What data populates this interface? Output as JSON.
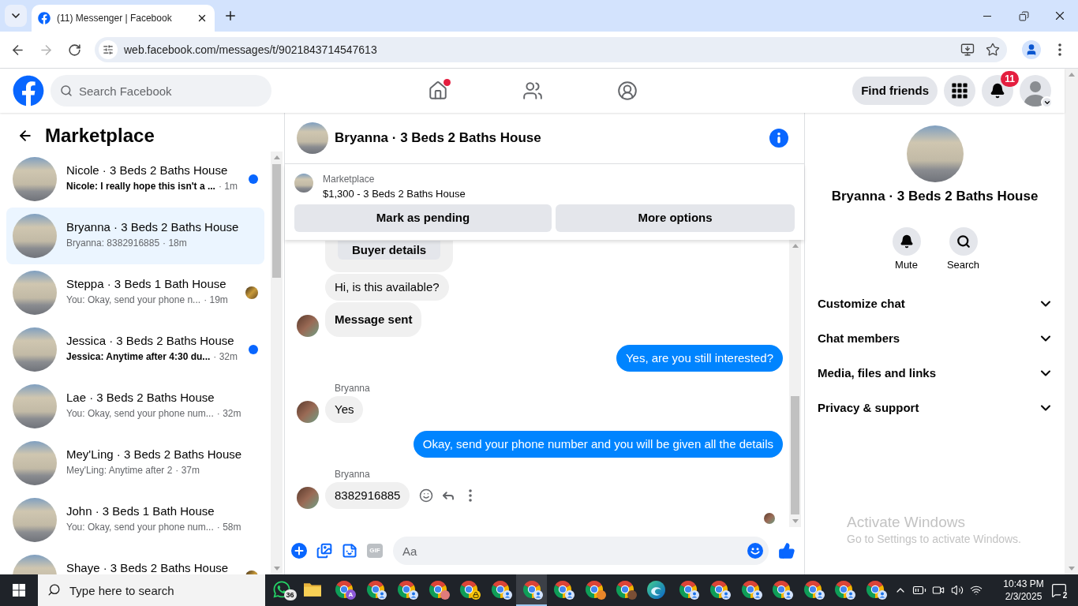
{
  "browser": {
    "tab": {
      "title": "(11) Messenger | Facebook"
    },
    "url": "web.facebook.com/messages/t/9021843714547613"
  },
  "header": {
    "search": {
      "placeholder": "Search Facebook"
    },
    "nav": [
      {
        "kind": "home",
        "selected": false,
        "alert": true
      },
      {
        "kind": "friends",
        "selected": false,
        "alert": false
      },
      {
        "kind": "groups",
        "selected": false,
        "alert": false
      }
    ],
    "find_friends": "Find friends",
    "notifications": "11"
  },
  "sidebar": {
    "title": "Marketplace",
    "conversations": [
      {
        "name": "Nicole · 3 Beds 2 Baths House",
        "preview": "Nicole: I really hope this isn't a ...",
        "time": "· 1m",
        "selected": false,
        "unread": true,
        "seen": false
      },
      {
        "name": "Bryanna · 3 Beds 2 Baths House",
        "preview": "Bryanna: 8382916885",
        "time": "· 18m",
        "selected": true,
        "unread": false,
        "seen": false
      },
      {
        "name": "Steppa · 3 Beds 1 Bath House",
        "preview": "You: Okay, send your phone n...",
        "time": "· 19m",
        "selected": false,
        "unread": false,
        "seen": true
      },
      {
        "name": "Jessica · 3 Beds 2 Baths House",
        "preview": "Jessica: Anytime after 4:30 du...",
        "time": "· 32m",
        "selected": false,
        "unread": true,
        "seen": false
      },
      {
        "name": "Lae · 3 Beds 2 Baths House",
        "preview": "You: Okay, send your phone num...",
        "time": "· 32m",
        "selected": false,
        "unread": false,
        "seen": false
      },
      {
        "name": "Mey'Ling · 3 Beds 2 Baths House",
        "preview": "Mey'Ling: Anytime after 2",
        "time": "· 37m",
        "selected": false,
        "unread": false,
        "seen": false
      },
      {
        "name": "John · 3 Beds 1 Bath House",
        "preview": "You: Okay, send your phone num...",
        "time": "· 58m",
        "selected": false,
        "unread": false,
        "seen": false
      },
      {
        "name": "Shaye · 3 Beds 2 Baths House",
        "selected": false,
        "unread": false,
        "seen": true
      }
    ]
  },
  "chat": {
    "title": "Bryanna · 3 Beds 2 Baths House",
    "listing": {
      "label": "Marketplace",
      "text": "$1,300 - 3 Beds 2 Baths House",
      "actions": [
        "Mark as pending",
        "More options"
      ]
    },
    "messages": [
      {
        "kind": "card",
        "outgoing": false,
        "button": "Buyer details",
        "avatar": false
      },
      {
        "kind": "text",
        "outgoing": false,
        "text": "Hi, is this available?",
        "avatar": false
      },
      {
        "kind": "notice",
        "outgoing": false,
        "text": "Message sent",
        "avatar": true
      },
      {
        "kind": "text",
        "outgoing": true,
        "text": "Yes, are you still interested?"
      },
      {
        "kind": "text",
        "outgoing": false,
        "sender": "Bryanna",
        "text": "Yes",
        "avatar": true
      },
      {
        "kind": "text",
        "outgoing": true,
        "text": "Okay, send your phone number and you will be given all the details"
      },
      {
        "kind": "text",
        "outgoing": false,
        "sender": "Bryanna",
        "text": "8382916885",
        "avatar": true,
        "actions": true
      }
    ],
    "seen": true,
    "composer": {
      "tools": [
        {
          "kind": "plus"
        },
        {
          "kind": "photo"
        },
        {
          "kind": "sticker"
        },
        {
          "kind": "gif",
          "label": "GIF"
        }
      ],
      "placeholder": "Aa"
    }
  },
  "details": {
    "title": "Bryanna · 3 Beds 2 Baths House",
    "actions": [
      {
        "kind": "mute",
        "label": "Mute"
      },
      {
        "kind": "search",
        "label": "Search"
      }
    ],
    "sections": [
      {
        "label": "Customize chat",
        "expanded": false
      },
      {
        "label": "Chat members",
        "expanded": false
      },
      {
        "label": "Media, files and links",
        "expanded": false
      },
      {
        "label": "Privacy & support",
        "expanded": false
      }
    ]
  },
  "windows_notice": {
    "title": "Activate Windows",
    "text": "Go to Settings to activate Windows."
  },
  "taskbar": {
    "search": {
      "placeholder": "Type here to search"
    },
    "apps": [
      {
        "kind": "whatsapp",
        "badge": "36",
        "active": false
      },
      {
        "kind": "folder",
        "active": false
      },
      {
        "kind": "chrome",
        "profile": {
          "kind": "letter",
          "letter": "A",
          "color": "#8e5bd9"
        },
        "active": false
      },
      {
        "kind": "chrome",
        "profile": {
          "kind": "person"
        },
        "active": false
      },
      {
        "kind": "chrome",
        "profile": {
          "kind": "person"
        },
        "active": false
      },
      {
        "kind": "chrome",
        "profile": {
          "kind": "photo",
          "color": "#e07b7b"
        },
        "active": false
      },
      {
        "kind": "chrome",
        "profile": {
          "kind": "lock"
        },
        "active": false
      },
      {
        "kind": "chrome",
        "profile": {
          "kind": "person"
        },
        "active": false
      },
      {
        "kind": "chrome",
        "profile": {
          "kind": "person"
        },
        "active": true
      },
      {
        "kind": "chrome",
        "profile": {
          "kind": "person"
        },
        "active": false
      },
      {
        "kind": "chrome",
        "profile": {
          "kind": "photo",
          "color": "#e8862a"
        },
        "active": false
      },
      {
        "kind": "chrome",
        "profile": {
          "kind": "photo",
          "color": "#7a4e35"
        },
        "active": false
      },
      {
        "kind": "edge",
        "active": false
      },
      {
        "kind": "chrome",
        "profile": {
          "kind": "person"
        },
        "active": false
      },
      {
        "kind": "chrome",
        "profile": {
          "kind": "person"
        },
        "active": false
      },
      {
        "kind": "chrome",
        "profile": {
          "kind": "person"
        },
        "active": false
      },
      {
        "kind": "chrome",
        "profile": {
          "kind": "person"
        },
        "active": false
      },
      {
        "kind": "chrome",
        "profile": {
          "kind": "person"
        },
        "active": false
      },
      {
        "kind": "chrome",
        "profile": {
          "kind": "person"
        },
        "active": false
      },
      {
        "kind": "chrome",
        "profile": {
          "kind": "person"
        },
        "active": false
      }
    ],
    "clock": {
      "time": "10:43 PM",
      "date": "2/3/2025"
    },
    "notifications": "2"
  }
}
